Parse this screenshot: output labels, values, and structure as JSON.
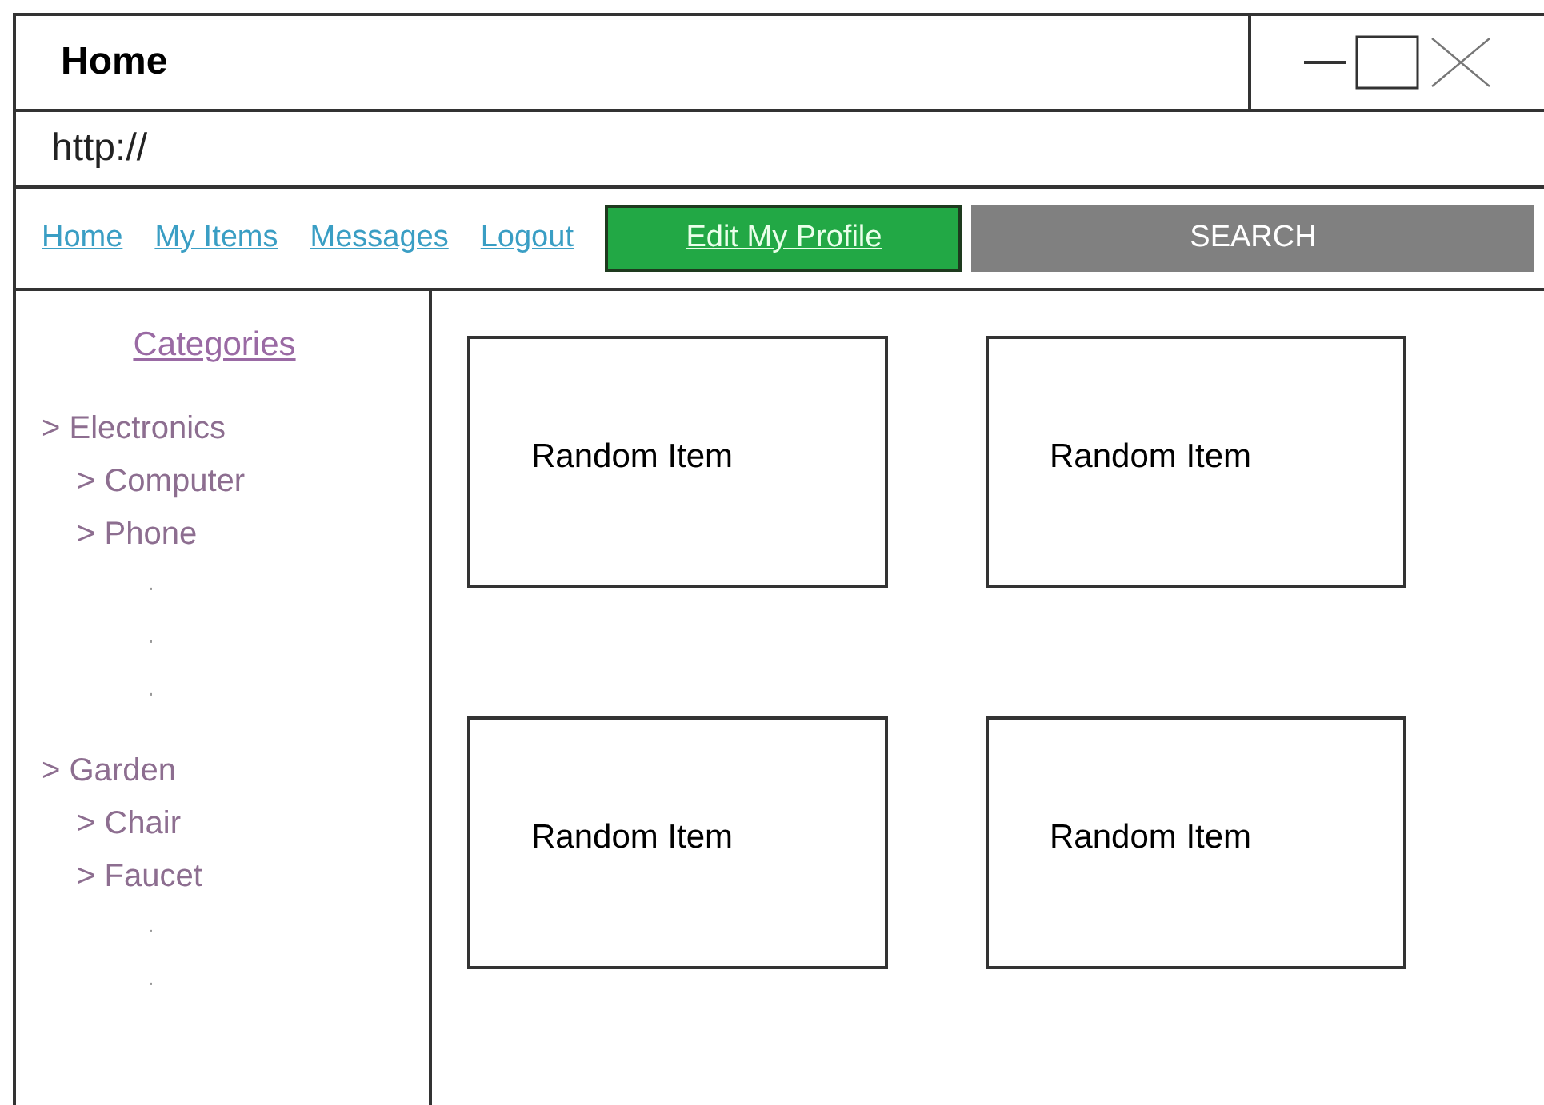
{
  "window": {
    "title": "Home",
    "controls": [
      {
        "kind": "minimize"
      },
      {
        "kind": "maximize"
      },
      {
        "kind": "close"
      }
    ]
  },
  "address_bar": {
    "value": "http://"
  },
  "nav": {
    "links": [
      "Home",
      "My Items",
      "Messages",
      "Logout"
    ],
    "buttons": [
      {
        "label": "Edit My Profile",
        "kind": "primary"
      },
      {
        "label": "SEARCH",
        "kind": "secondary"
      }
    ]
  },
  "sidebar": {
    "title": "Categories",
    "items": [
      {
        "label": "> Electronics",
        "children": [
          {
            "label": "> Computer"
          },
          {
            "label": "> Phone"
          }
        ],
        "more": [
          "·",
          "·",
          "·"
        ]
      },
      {
        "label": "> Garden",
        "children": [
          {
            "label": "> Chair"
          },
          {
            "label": "> Faucet"
          }
        ],
        "more": [
          "·",
          "·"
        ]
      }
    ]
  },
  "items": [
    {
      "title": "Random Item"
    },
    {
      "title": "Random Item"
    },
    {
      "title": "Random Item"
    },
    {
      "title": "Random Item"
    }
  ]
}
